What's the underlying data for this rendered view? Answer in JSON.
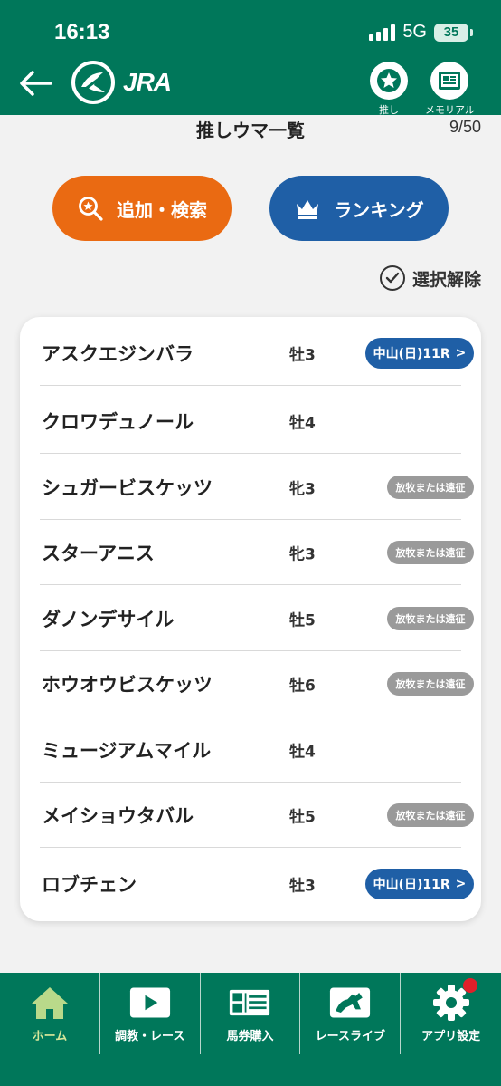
{
  "status_bar": {
    "time": "16:13",
    "network": "5G",
    "battery": "35"
  },
  "header": {
    "logo_text": "JRA",
    "oshi_label": "推し",
    "memorial_label": "メモリアル"
  },
  "page": {
    "title": "推しウマ一覧",
    "count": "9/50"
  },
  "actions": {
    "search_label": "追加・検索",
    "ranking_label": "ランキング",
    "deselect_label": "選択解除"
  },
  "horses": [
    {
      "name": "アスクエジンバラ",
      "sex_age": "牡3",
      "badge_type": "race",
      "badge": "中山(日)11R",
      "chevron": ">"
    },
    {
      "name": "クロワデュノール",
      "sex_age": "牡4",
      "badge_type": "none",
      "badge": ""
    },
    {
      "name": "シュガービスケッツ",
      "sex_age": "牝3",
      "badge_type": "status",
      "badge": "放牧または遠征"
    },
    {
      "name": "スターアニス",
      "sex_age": "牝3",
      "badge_type": "status",
      "badge": "放牧または遠征"
    },
    {
      "name": "ダノンデサイル",
      "sex_age": "牡5",
      "badge_type": "status",
      "badge": "放牧または遠征"
    },
    {
      "name": "ホウオウビスケッツ",
      "sex_age": "牡6",
      "badge_type": "status",
      "badge": "放牧または遠征"
    },
    {
      "name": "ミュージアムマイル",
      "sex_age": "牡4",
      "badge_type": "none",
      "badge": ""
    },
    {
      "name": "メイショウタバル",
      "sex_age": "牡5",
      "badge_type": "status",
      "badge": "放牧または遠征"
    },
    {
      "name": "ロブチェン",
      "sex_age": "牡3",
      "badge_type": "race",
      "badge": "中山(日)11R",
      "chevron": ">"
    }
  ],
  "bottom_nav": [
    {
      "label": "ホーム",
      "icon": "home-icon",
      "active": true
    },
    {
      "label": "調教・レース",
      "icon": "play-icon",
      "active": false
    },
    {
      "label": "馬券購入",
      "icon": "ticket-icon",
      "active": false
    },
    {
      "label": "レースライブ",
      "icon": "horse-live-icon",
      "active": false
    },
    {
      "label": "アプリ設定",
      "icon": "gear-icon",
      "active": false
    }
  ],
  "colors": {
    "brand_green": "#00775a",
    "search_orange": "#ea6a12",
    "ranking_blue": "#1f5fa6",
    "status_gray": "#9a9a9a",
    "notification_red": "#e0202a"
  }
}
